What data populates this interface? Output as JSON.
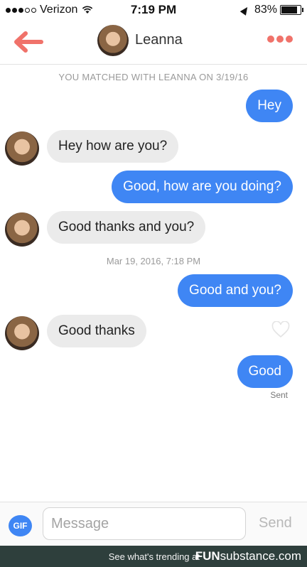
{
  "status_bar": {
    "carrier": "Verizon",
    "time": "7:19 PM",
    "battery": "83%",
    "battery_level": 0.83
  },
  "header": {
    "contact_name": "Leanna",
    "back_icon": "back-arrow-icon",
    "more_icon": "more-options-icon",
    "accent_color": "#f0726a"
  },
  "conversation": {
    "match_banner": "YOU MATCHED WITH LEANNA ON 3/19/16",
    "timestamp": "Mar 19, 2016, 7:18 PM",
    "messages": [
      {
        "direction": "out",
        "text": "Hey"
      },
      {
        "direction": "in",
        "text": "Hey how are you?"
      },
      {
        "direction": "out",
        "text": "Good, how are you doing?"
      },
      {
        "direction": "in",
        "text": "Good thanks and you?"
      },
      {
        "direction": "out",
        "text": "Good and you?"
      },
      {
        "direction": "in",
        "text": "Good thanks"
      },
      {
        "direction": "out",
        "text": "Good"
      }
    ],
    "sent_status": "Sent",
    "outgoing_color": "#3f86f4",
    "incoming_color": "#ebebeb"
  },
  "composer": {
    "gif_label": "GIF",
    "placeholder": "Message",
    "value": "",
    "send_label": "Send"
  },
  "footer": {
    "tagline": "See what's trending at",
    "brand_bold": "FUN",
    "brand_rest": "substance.com"
  }
}
